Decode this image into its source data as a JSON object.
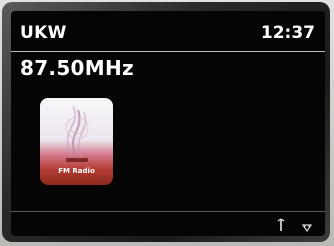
{
  "header": {
    "mode": "UKW",
    "time": "12:37"
  },
  "tuner": {
    "frequency": "87.50MHz"
  },
  "station_logo": {
    "caption": "FM Radio",
    "icon": "radio-waves-icon"
  },
  "status_bar": {
    "icons": [
      "antenna-icon",
      "signal-icon"
    ]
  },
  "colors": {
    "screen": "#050505",
    "text": "#ffffff",
    "logo_top": "#f7f7f9",
    "logo_bottom": "#8b2a1e"
  }
}
